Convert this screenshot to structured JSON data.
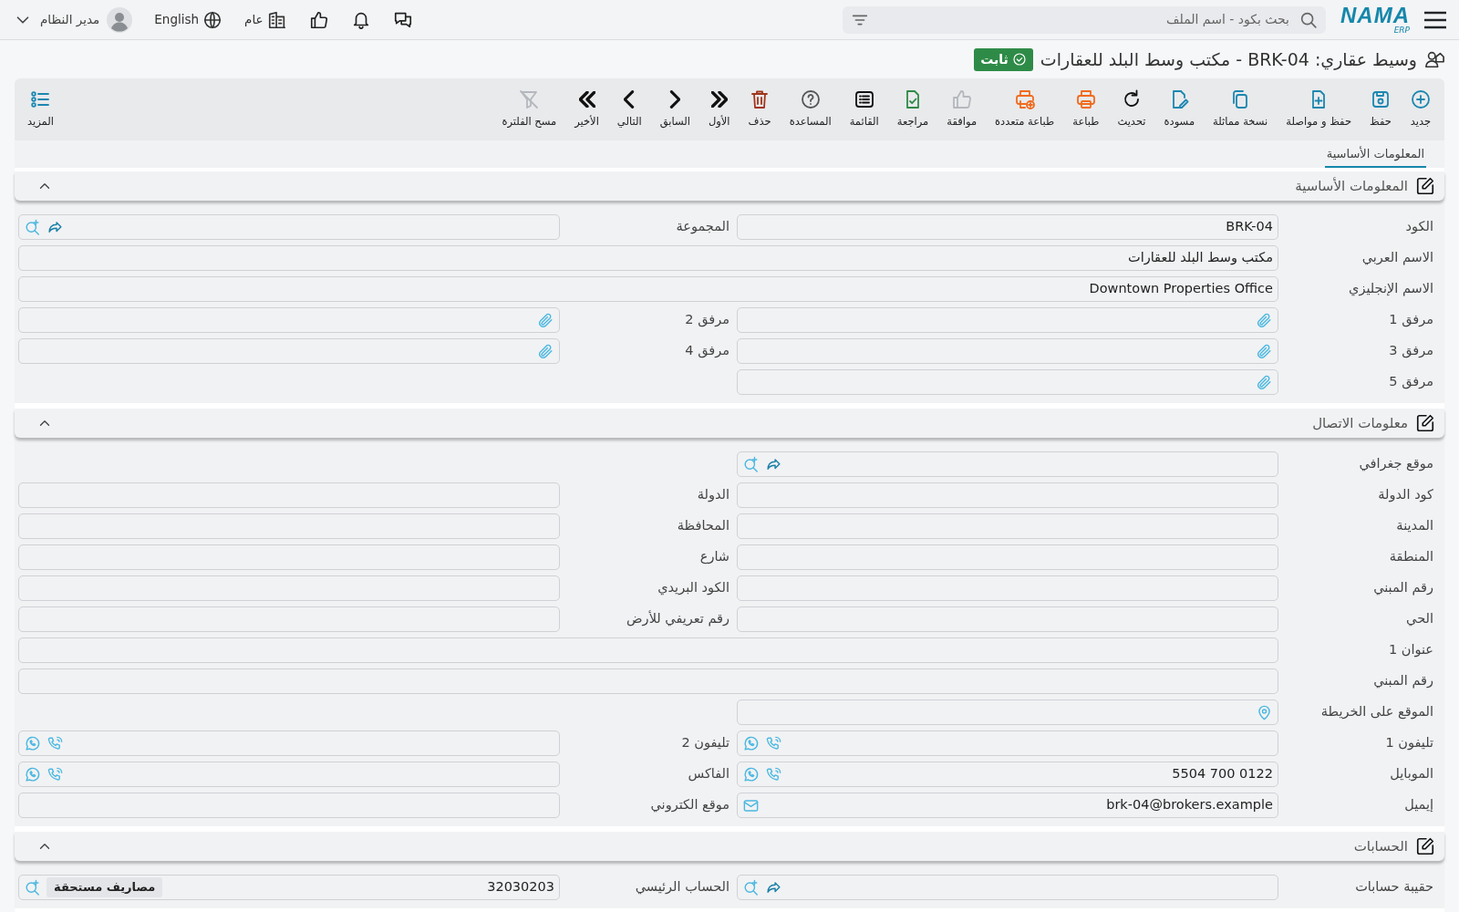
{
  "top_bar": {
    "logo": {
      "name": "NAMA",
      "sub": "ERP"
    },
    "search": {
      "placeholder": "بحث بكود - اسم الملف"
    },
    "company": "عام",
    "language": "English",
    "user": "مدير النظام"
  },
  "title": {
    "text": "وسيط عقاري: BRK-04 - مكتب وسط البلد للعقارات",
    "status": "ثابت"
  },
  "toolbar": [
    {
      "kind": "new",
      "label": "جديد",
      "color": "#1a87b0"
    },
    {
      "kind": "save",
      "label": "حفظ",
      "color": "#1a87b0"
    },
    {
      "kind": "save-continue",
      "label": "حفظ و مواصلة",
      "color": "#1a87b0"
    },
    {
      "kind": "copy",
      "label": "نسخة مماثلة",
      "color": "#1a87b0"
    },
    {
      "kind": "draft",
      "label": "مسودة",
      "color": "#1a87b0"
    },
    {
      "kind": "refresh",
      "label": "تحديث",
      "color": "#111111"
    },
    {
      "kind": "print",
      "label": "طباعة",
      "color": "#f06a1d"
    },
    {
      "kind": "multi-print",
      "label": "طباعة متعددة",
      "color": "#f06a1d"
    },
    {
      "kind": "approve",
      "label": "موافقة",
      "color": "#b4b8bd"
    },
    {
      "kind": "review",
      "label": "مراجعة",
      "color": "#2e8b47"
    },
    {
      "kind": "list",
      "label": "القائمة",
      "color": "#111111"
    },
    {
      "kind": "help",
      "label": "المساعدة",
      "color": "#555555"
    },
    {
      "kind": "delete",
      "label": "حذف",
      "color": "#a0341c"
    },
    {
      "kind": "first",
      "label": "الأول",
      "color": "#111111"
    },
    {
      "kind": "prev",
      "label": "السابق",
      "color": "#111111"
    },
    {
      "kind": "next",
      "label": "التالي",
      "color": "#111111"
    },
    {
      "kind": "last",
      "label": "الأخير",
      "color": "#111111"
    },
    {
      "kind": "clear-filter",
      "label": "مسح الفلترة",
      "color": "#b4b8bd"
    },
    {
      "kind": "more",
      "label": "المزيد",
      "color": "#1a87b0"
    }
  ],
  "tabs": [
    {
      "label": "المعلومات الأساسية",
      "selected": true
    }
  ],
  "sections": [
    {
      "title": "المعلومات الأساسية",
      "expanded": true,
      "rows": [
        {
          "right": {
            "label": "الكود",
            "kind": "text",
            "value": "BRK-04"
          },
          "left": {
            "label": "المجموعة",
            "kind": "lookup"
          }
        },
        {
          "full": {
            "label": "الاسم العربي",
            "kind": "text",
            "value": "مكتب وسط البلد للعقارات"
          }
        },
        {
          "full": {
            "label": "الاسم الإنجليزي",
            "kind": "text",
            "value": "Downtown Properties Office"
          }
        },
        {
          "right": {
            "label": "مرفق 1",
            "kind": "attachment"
          },
          "left": {
            "label": "مرفق 2",
            "kind": "attachment"
          }
        },
        {
          "right": {
            "label": "مرفق 3",
            "kind": "attachment"
          },
          "left": {
            "label": "مرفق 4",
            "kind": "attachment"
          }
        },
        {
          "right": {
            "label": "مرفق 5",
            "kind": "attachment"
          }
        }
      ]
    },
    {
      "title": "معلومات الاتصال",
      "expanded": true,
      "rows": [
        {
          "right": {
            "label": "موقع جغرافي",
            "kind": "lookup"
          }
        },
        {
          "right": {
            "label": "كود الدولة",
            "kind": "text"
          },
          "left": {
            "label": "الدولة",
            "kind": "text"
          }
        },
        {
          "right": {
            "label": "المدينة",
            "kind": "text"
          },
          "left": {
            "label": "المحافظة",
            "kind": "text"
          }
        },
        {
          "right": {
            "label": "المنطقة",
            "kind": "text"
          },
          "left": {
            "label": "شارع",
            "kind": "text"
          }
        },
        {
          "right": {
            "label": "رقم المبني",
            "kind": "text"
          },
          "left": {
            "label": "الكود البريدي",
            "kind": "text"
          }
        },
        {
          "right": {
            "label": "الحي",
            "kind": "text"
          },
          "left": {
            "label": "رقم تعريفي للأرض",
            "kind": "text"
          }
        },
        {
          "full": {
            "label": "عنوان 1",
            "kind": "text"
          }
        },
        {
          "full": {
            "label": "رقم المبني",
            "kind": "text"
          }
        },
        {
          "right": {
            "label": "الموقع على الخريطة",
            "kind": "map"
          }
        },
        {
          "right": {
            "label": "تليفون 1",
            "kind": "phone"
          },
          "left": {
            "label": "تليفون 2",
            "kind": "phone"
          }
        },
        {
          "right": {
            "label": "الموبايل",
            "kind": "phone",
            "value": "5504 700 0122"
          },
          "left": {
            "label": "الفاكس",
            "kind": "phone"
          }
        },
        {
          "right": {
            "label": "إيميل",
            "kind": "email",
            "value": "brk-04@brokers.example"
          },
          "left": {
            "label": "موقع الكتروني",
            "kind": "text"
          }
        }
      ]
    },
    {
      "title": "الحسابات",
      "expanded": true,
      "rows": [
        {
          "right": {
            "label": "حقيبة حسابات",
            "kind": "lookup"
          },
          "left": {
            "label": "الحساب الرئيسي",
            "kind": "account",
            "value": "32030203",
            "tag": "مصاريف مستحقة"
          }
        }
      ]
    }
  ]
}
